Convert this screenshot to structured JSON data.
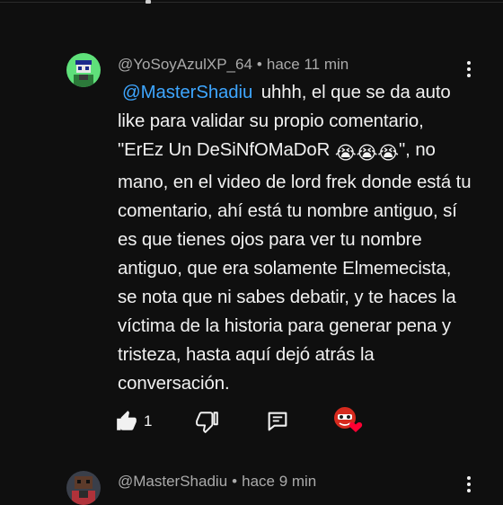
{
  "comments": [
    {
      "author": "@YoSoyAzulXP_64",
      "time": "hace 11 min",
      "mention": "@MasterShadiu",
      "text_part1": "uhhh, el que se da auto like para validar su propio comentario, \"ErEz Un DeSiNfOMaDoR ",
      "emoji": "😭😭😭",
      "text_part2": "\", no mano, en el video de lord frek donde está tu comentario, ahí está tu nombre antiguo, sí es que tienes ojos para ver tu nombre antiguo, que era solamente Elmemecista, se nota que ni sabes debatir, y te haces la víctima de la historia para generar pena y tristeza, hasta aquí dejó atrás la conversación.",
      "like_count": "1",
      "icons": {
        "like": "thumbs-up-icon",
        "dislike": "thumbs-down-icon",
        "reply": "reply-comment-icon",
        "creator_heart": "creator-heart-badge",
        "menu": "more-vert-icon"
      }
    },
    {
      "author": "@MasterShadiu",
      "time": "hace 9 min",
      "icons": {
        "menu": "more-vert-icon"
      }
    }
  ],
  "colors": {
    "background": "#0f0f0f",
    "text": "#f1f1f1",
    "meta": "#aaaaaa",
    "mention": "#3ea6ff",
    "heart": "#ff0033"
  }
}
